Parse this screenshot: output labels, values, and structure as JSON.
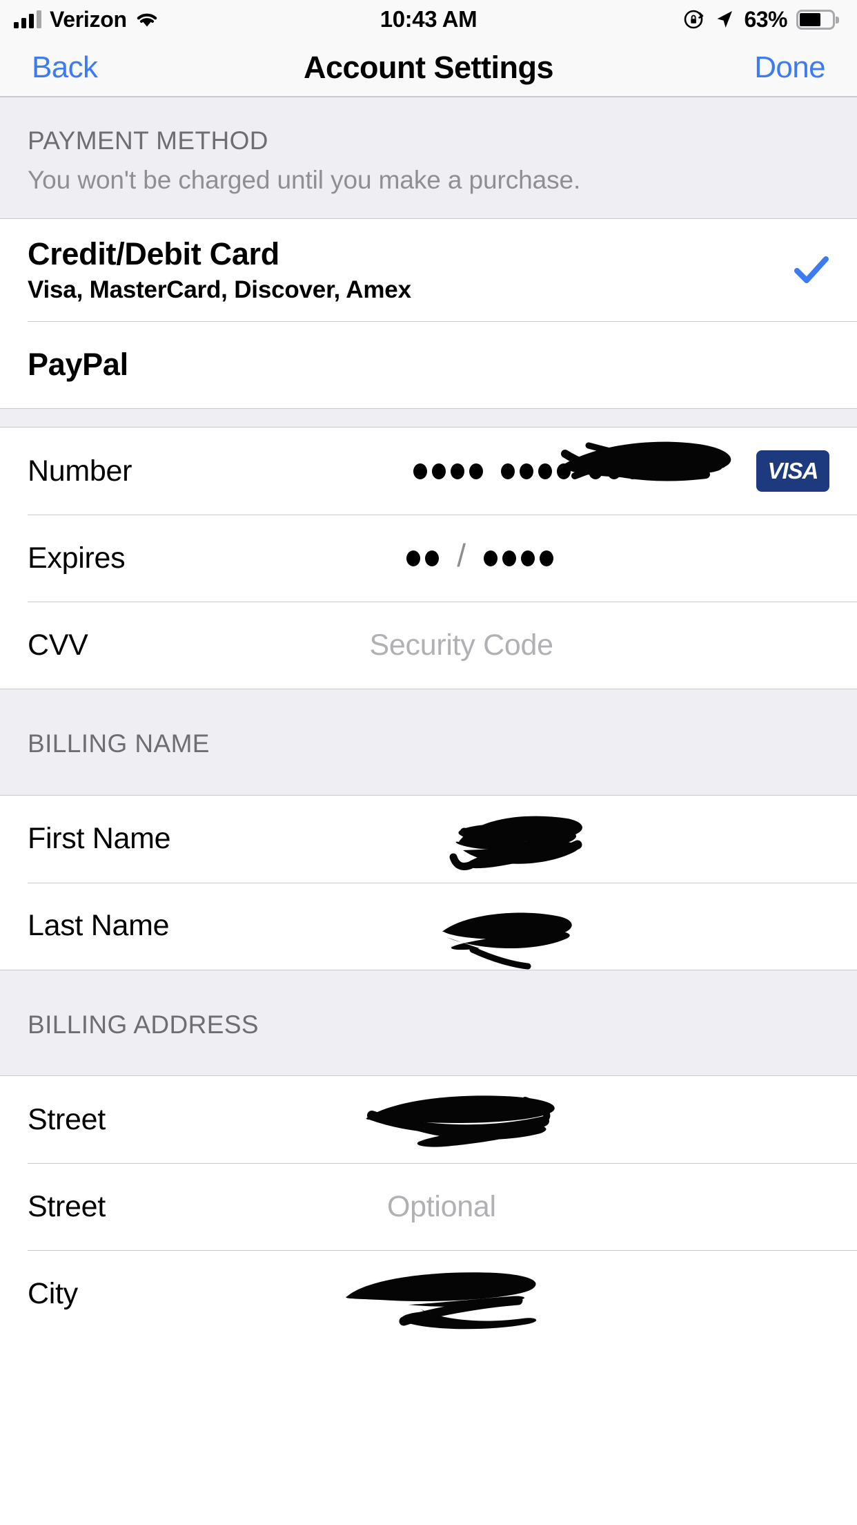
{
  "status_bar": {
    "carrier": "Verizon",
    "signal_icon": "signal-bars-icon",
    "wifi_icon": "wifi-icon",
    "time": "10:43 AM",
    "rotation_lock_icon": "rotation-lock-icon",
    "location_icon": "location-arrow-icon",
    "battery_percent": "63%",
    "battery_icon": "battery-icon",
    "battery_level": 63
  },
  "nav_bar": {
    "back_label": "Back",
    "title": "Account Settings",
    "done_label": "Done",
    "tint_color": "#3c7bf1"
  },
  "payment_method_section": {
    "header": "PAYMENT METHOD",
    "footer_note": "You won't be charged until you make a purchase.",
    "options": [
      {
        "label": "Credit/Debit Card",
        "sublabel": "Visa, MasterCard, Discover, Amex",
        "selected": true,
        "check_icon": "checkmark-icon"
      },
      {
        "label": "PayPal",
        "sublabel": "",
        "selected": false,
        "check_icon": "checkmark-icon"
      }
    ]
  },
  "card_details_section": {
    "rows": [
      {
        "label": "Number",
        "value_type": "masked-dots",
        "dot_groups": [
          4,
          4,
          4
        ],
        "redacted": true,
        "brand_badge": "VISA",
        "brand_badge_color": "#1d3a7f"
      },
      {
        "label": "Expires",
        "value_type": "masked-expiry",
        "month_dots": 2,
        "separator": "/",
        "year_dots": 4,
        "redacted": false
      },
      {
        "label": "CVV",
        "value_type": "placeholder",
        "placeholder": "Security Code",
        "redacted": false
      }
    ]
  },
  "billing_name_section": {
    "header": "BILLING NAME",
    "rows": [
      {
        "label": "First Name",
        "value_type": "redacted",
        "placeholder": ""
      },
      {
        "label": "Last Name",
        "value_type": "redacted",
        "placeholder": ""
      }
    ]
  },
  "billing_address_section": {
    "header": "BILLING ADDRESS",
    "rows": [
      {
        "label": "Street",
        "value_type": "redacted",
        "placeholder": ""
      },
      {
        "label": "Street",
        "value_type": "placeholder",
        "placeholder": "Optional"
      },
      {
        "label": "City",
        "value_type": "redacted",
        "placeholder": ""
      }
    ]
  },
  "colors": {
    "accent": "#3c7bf1",
    "group_background": "#eeeef3",
    "separator": "#c9c9cf",
    "placeholder_text": "#b0b0b5",
    "header_text": "#6d6d72",
    "visa_blue": "#1d3a7f"
  }
}
